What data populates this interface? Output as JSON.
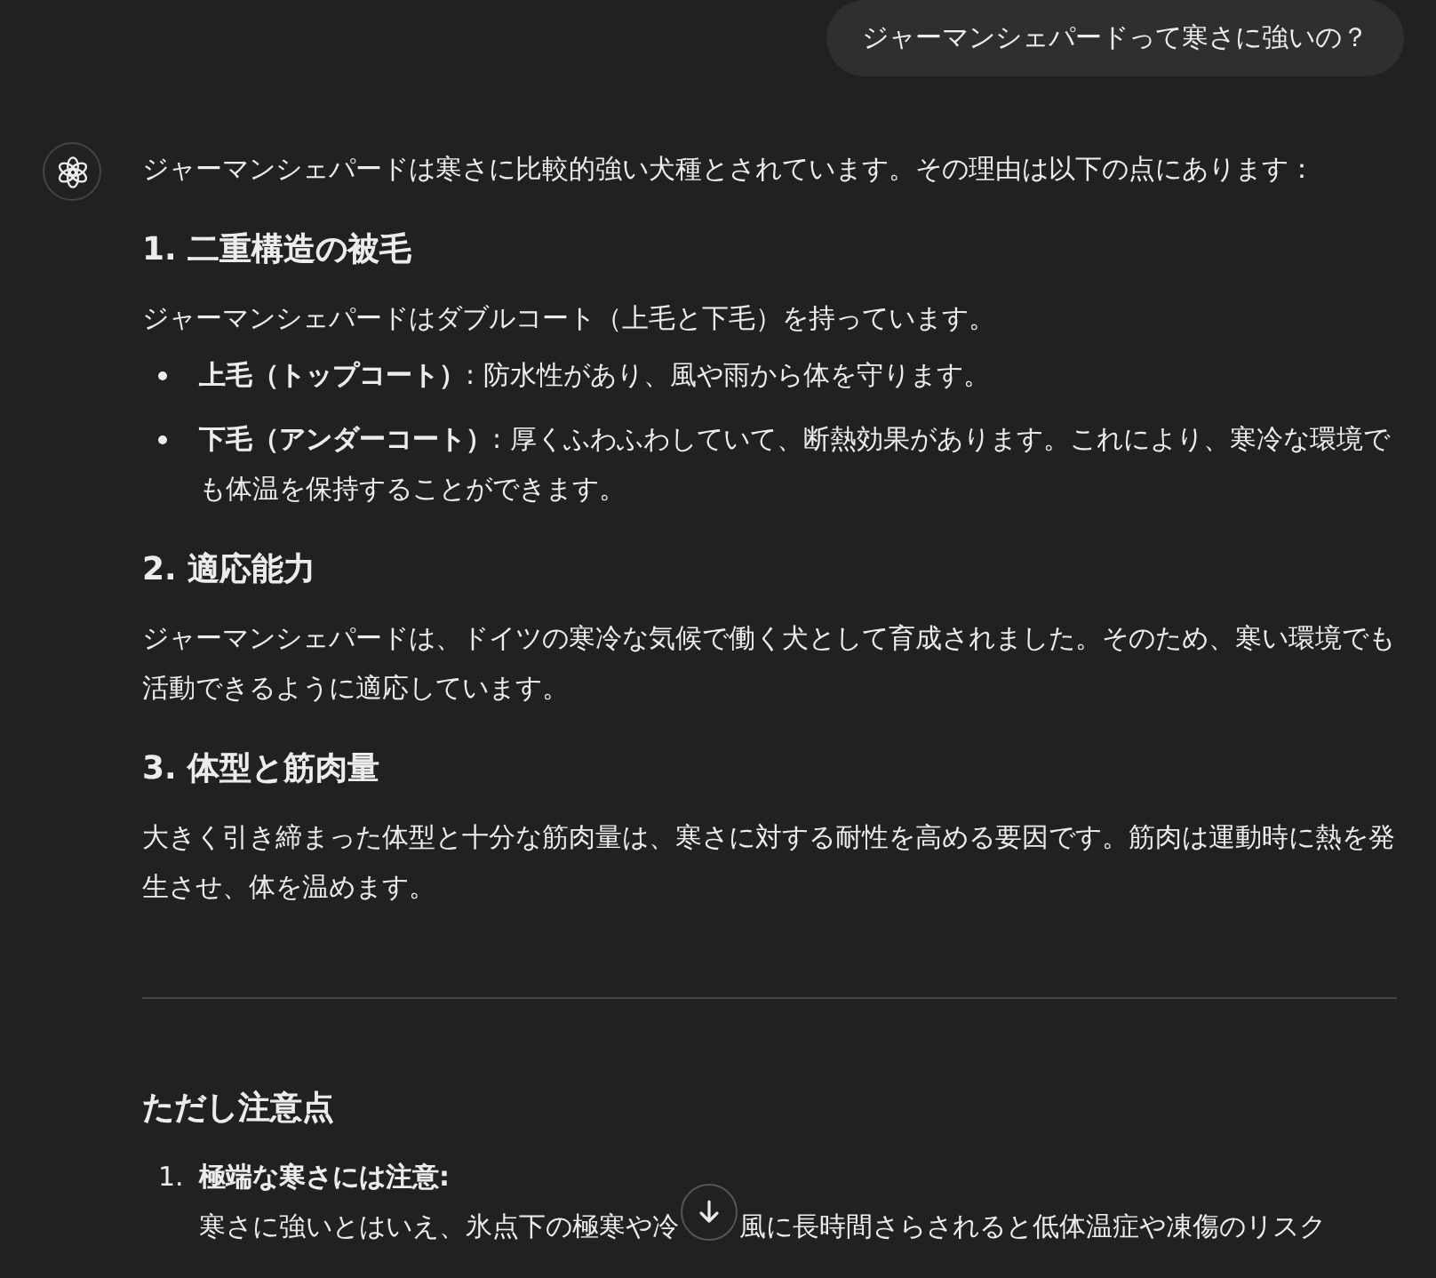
{
  "user_message": "ジャーマンシェパードって寒さに強いの？",
  "assistant": {
    "intro": "ジャーマンシェパードは寒さに比較的強い犬種とされています。その理由は以下の点にあります：",
    "sections": [
      {
        "heading": "1. 二重構造の被毛",
        "paragraph": "ジャーマンシェパードはダブルコート（上毛と下毛）を持っています。",
        "bullets": [
          "**上毛（トップコート）**: 防水性があり、風や雨から体を守ります。",
          "**下毛（アンダーコート）**: 厚くふわふわしていて、断熱効果があります。これにより、寒冷な環境でも体温を保持することができます。"
        ]
      },
      {
        "heading": "2. 適応能力",
        "paragraph": "ジャーマンシェパードは、ドイツの寒冷な気候で働く犬として育成されました。そのため、寒い環境でも活動できるように適応しています。"
      },
      {
        "heading": "3. 体型と筋肉量",
        "paragraph": "大きく引き締まった体型と十分な筋肉量は、寒さに対する耐性を高める要因です。筋肉は運動時に熱を発生させ、体を温めます。"
      }
    ],
    "caution": {
      "heading": "ただし注意点",
      "items": [
        {
          "number": "1.",
          "term": "極端な寒さには注意:",
          "text_parts": [
            "寒さに強いとはいえ、氷点下の極寒や冷",
            "風に長時間さらされると低体温症や凍傷のリスク"
          ]
        }
      ]
    }
  }
}
